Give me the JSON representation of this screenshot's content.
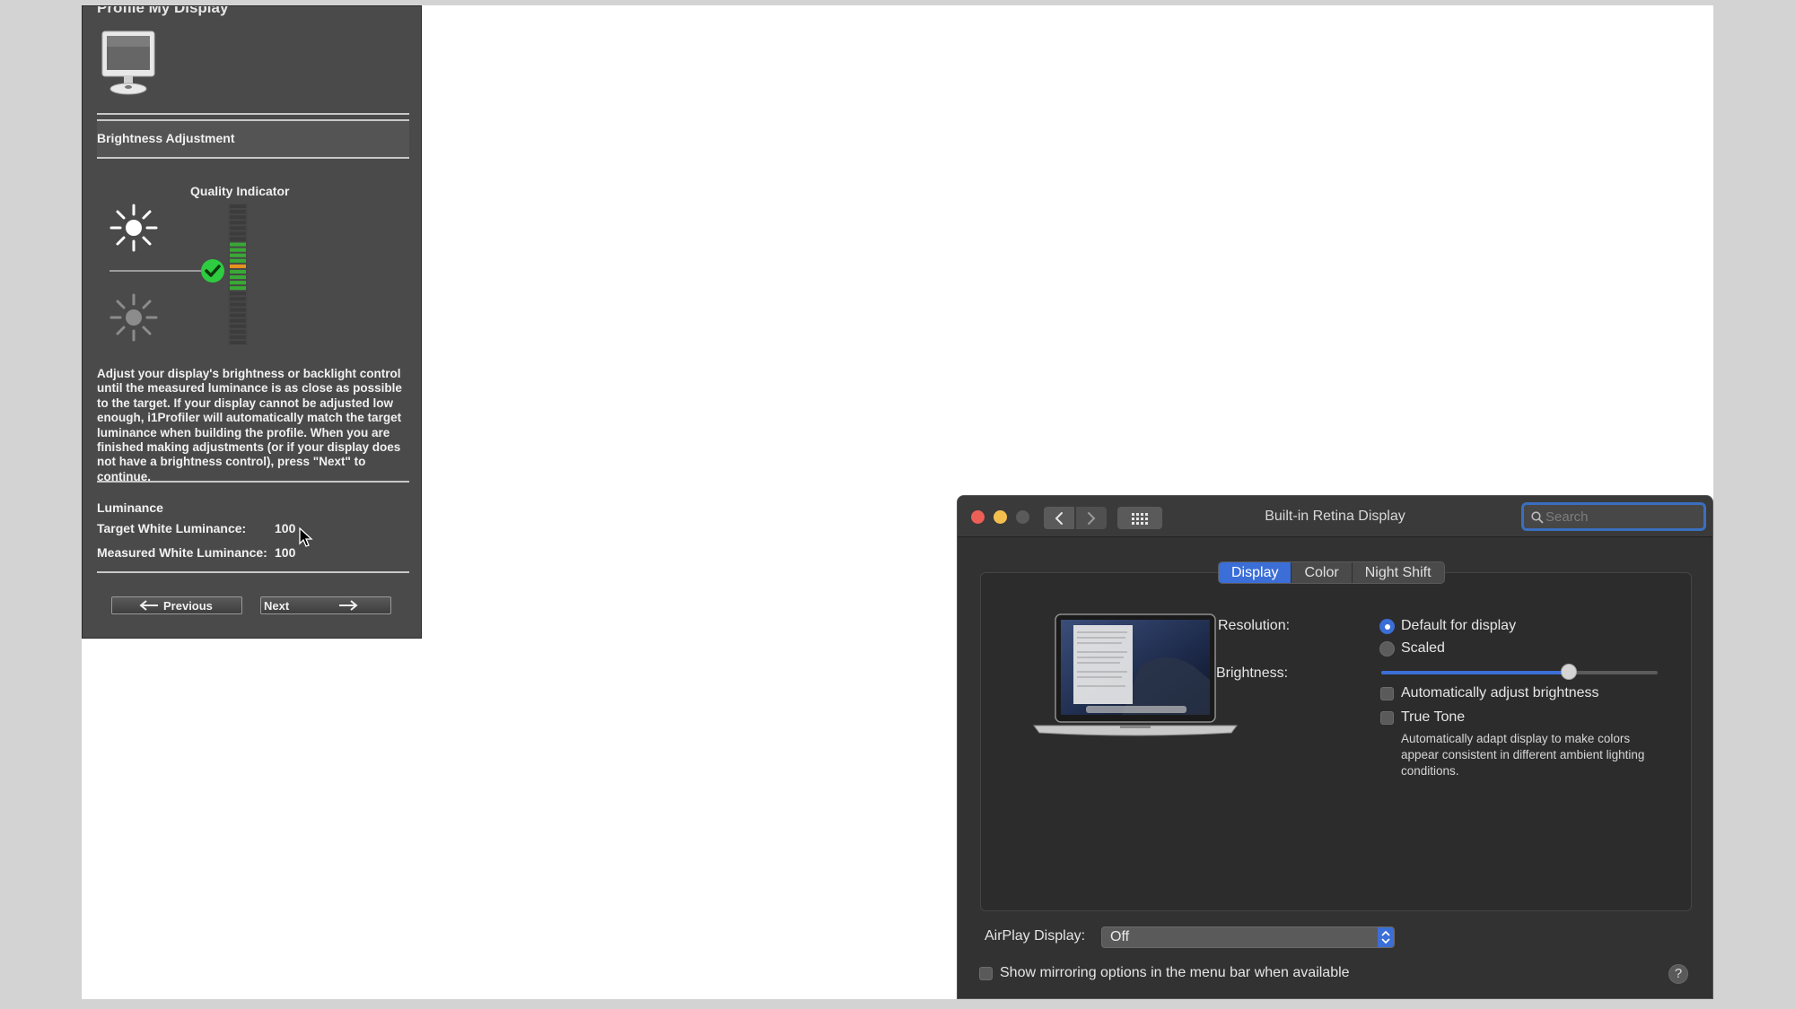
{
  "i1_profiler": {
    "title": "Profile My Display",
    "section_title": "Brightness Adjustment",
    "quality_indicator_label": "Quality Indicator",
    "quality_level": 0.58,
    "description": "Adjust your display's brightness or backlight control until the measured luminance is as close as possible to the target.  If your display cannot be adjusted low enough, i1Profiler will automatically match the target luminance when building the profile.  When you are finished making adjustments (or if your display does not have a brightness control), press \"Next\" to continue.",
    "luminance_heading": "Luminance",
    "target_label": "Target White Luminance:",
    "target_value": "100",
    "measured_label": "Measured White Luminance:",
    "measured_value": "100",
    "previous_label": "Previous",
    "next_label": "Next"
  },
  "display_prefs": {
    "window_title": "Built-in Retina Display",
    "search_placeholder": "Search",
    "tabs": [
      {
        "label": "Display",
        "active": true
      },
      {
        "label": "Color",
        "active": false
      },
      {
        "label": "Night Shift",
        "active": false
      }
    ],
    "resolution_label": "Resolution:",
    "resolution_options": [
      {
        "label": "Default for display",
        "selected": true
      },
      {
        "label": "Scaled",
        "selected": false
      }
    ],
    "brightness_label": "Brightness:",
    "brightness_level": 0.68,
    "auto_brightness_label": "Automatically adjust brightness",
    "auto_brightness_checked": false,
    "true_tone_label": "True Tone",
    "true_tone_checked": false,
    "true_tone_description": "Automatically adapt display to make colors appear consistent in different ambient lighting conditions.",
    "airplay_label": "AirPlay Display:",
    "airplay_value": "Off",
    "mirroring_label": "Show mirroring options in the menu bar when available",
    "mirroring_checked": false,
    "help_label": "?"
  },
  "colors": {
    "accent_blue": "#3b6ed6",
    "check_green": "#2ecc40",
    "meter_orange": "#e8931e",
    "close_red": "#ec5f56",
    "minimize_yellow": "#f4be4f"
  },
  "icons": [
    "monitor-icon",
    "sun-bright-icon",
    "sun-dim-icon",
    "checkmark-icon",
    "arrow-left-icon",
    "arrow-right-icon",
    "cursor-icon",
    "chevron-left-icon",
    "chevron-right-icon",
    "grid-icon",
    "search-icon",
    "laptop-image",
    "help-icon"
  ]
}
